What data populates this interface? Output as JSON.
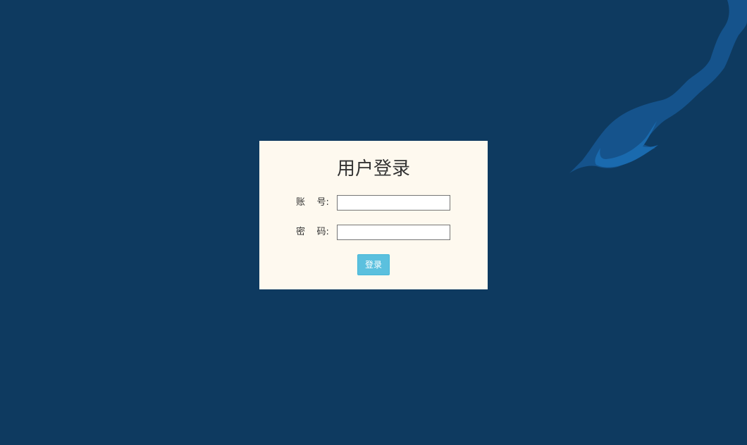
{
  "page": {
    "background_color": "#0e3a60",
    "decoration_colors": [
      "#15538c",
      "#1a6aae"
    ]
  },
  "login": {
    "title": "用户登录",
    "account_label": "账    号:",
    "account_value": "",
    "password_label": "密    码:",
    "password_value": "",
    "submit_label": "登录",
    "panel_color": "#fef9ef",
    "button_color": "#5bc0de"
  }
}
